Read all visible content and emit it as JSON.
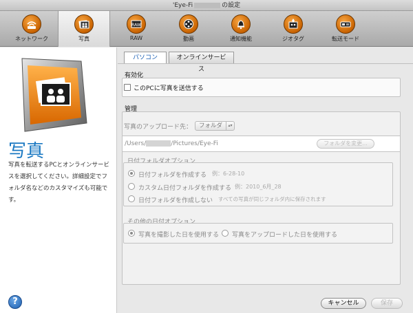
{
  "window": {
    "title_prefix": "'Eye-Fi",
    "title_suffix": "の設定"
  },
  "toolbar": {
    "items": [
      {
        "label": "ネットワーク",
        "icon": "wifi-icon"
      },
      {
        "label": "写真",
        "icon": "photos-icon",
        "active": true
      },
      {
        "label": "RAW",
        "icon": "raw-icon"
      },
      {
        "label": "動画",
        "icon": "film-reel-icon"
      },
      {
        "label": "通知機能",
        "icon": "bell-icon"
      },
      {
        "label": "ジオタグ",
        "icon": "geotag-photo-icon"
      },
      {
        "label": "転送モード",
        "icon": "transfer-mode-icon"
      }
    ]
  },
  "sidebar": {
    "title": "写真",
    "description": "写真を転送するPCとオンラインサービスを選択してください。詳細設定でフォルダ名などのカスタマイズも可能です。",
    "help_label": "?"
  },
  "tabs": [
    {
      "label": "パソコン",
      "active": true
    },
    {
      "label": "オンラインサービス",
      "active": false
    }
  ],
  "enable": {
    "group_label": "有効化",
    "checkbox_label": "このPCに写真を送信する",
    "checked": false
  },
  "manage": {
    "group_label": "管理",
    "upload_label": "写真のアップロード先：",
    "upload_select": "フォルダ",
    "path_prefix": "/Users/",
    "path_suffix": "/Pictures/Eye-Fi",
    "change_button": "フォルダを変更..."
  },
  "date_folder": {
    "group_label": "日付フォルダオプション",
    "options": [
      {
        "label": "日付フォルダを作成する",
        "example": "例：6-28-10",
        "selected": true
      },
      {
        "label": "カスタム日付フォルダを作成する",
        "example": "例：2010_6月_28",
        "selected": false
      },
      {
        "label": "日付フォルダを作成しない",
        "example": "すべての写真が同じフォルダ内に保存されます",
        "selected": false
      }
    ]
  },
  "other_date": {
    "group_label": "その他の日付オプション",
    "options": [
      {
        "label": "写真を撮影した日を使用する",
        "selected": true
      },
      {
        "label": "写真をアップロードした日を使用する",
        "selected": false
      }
    ]
  },
  "footer": {
    "cancel_label": "キャンセル",
    "save_label": "保存"
  },
  "colors": {
    "accent": "#1a78c2",
    "orange": "#e07a10"
  }
}
